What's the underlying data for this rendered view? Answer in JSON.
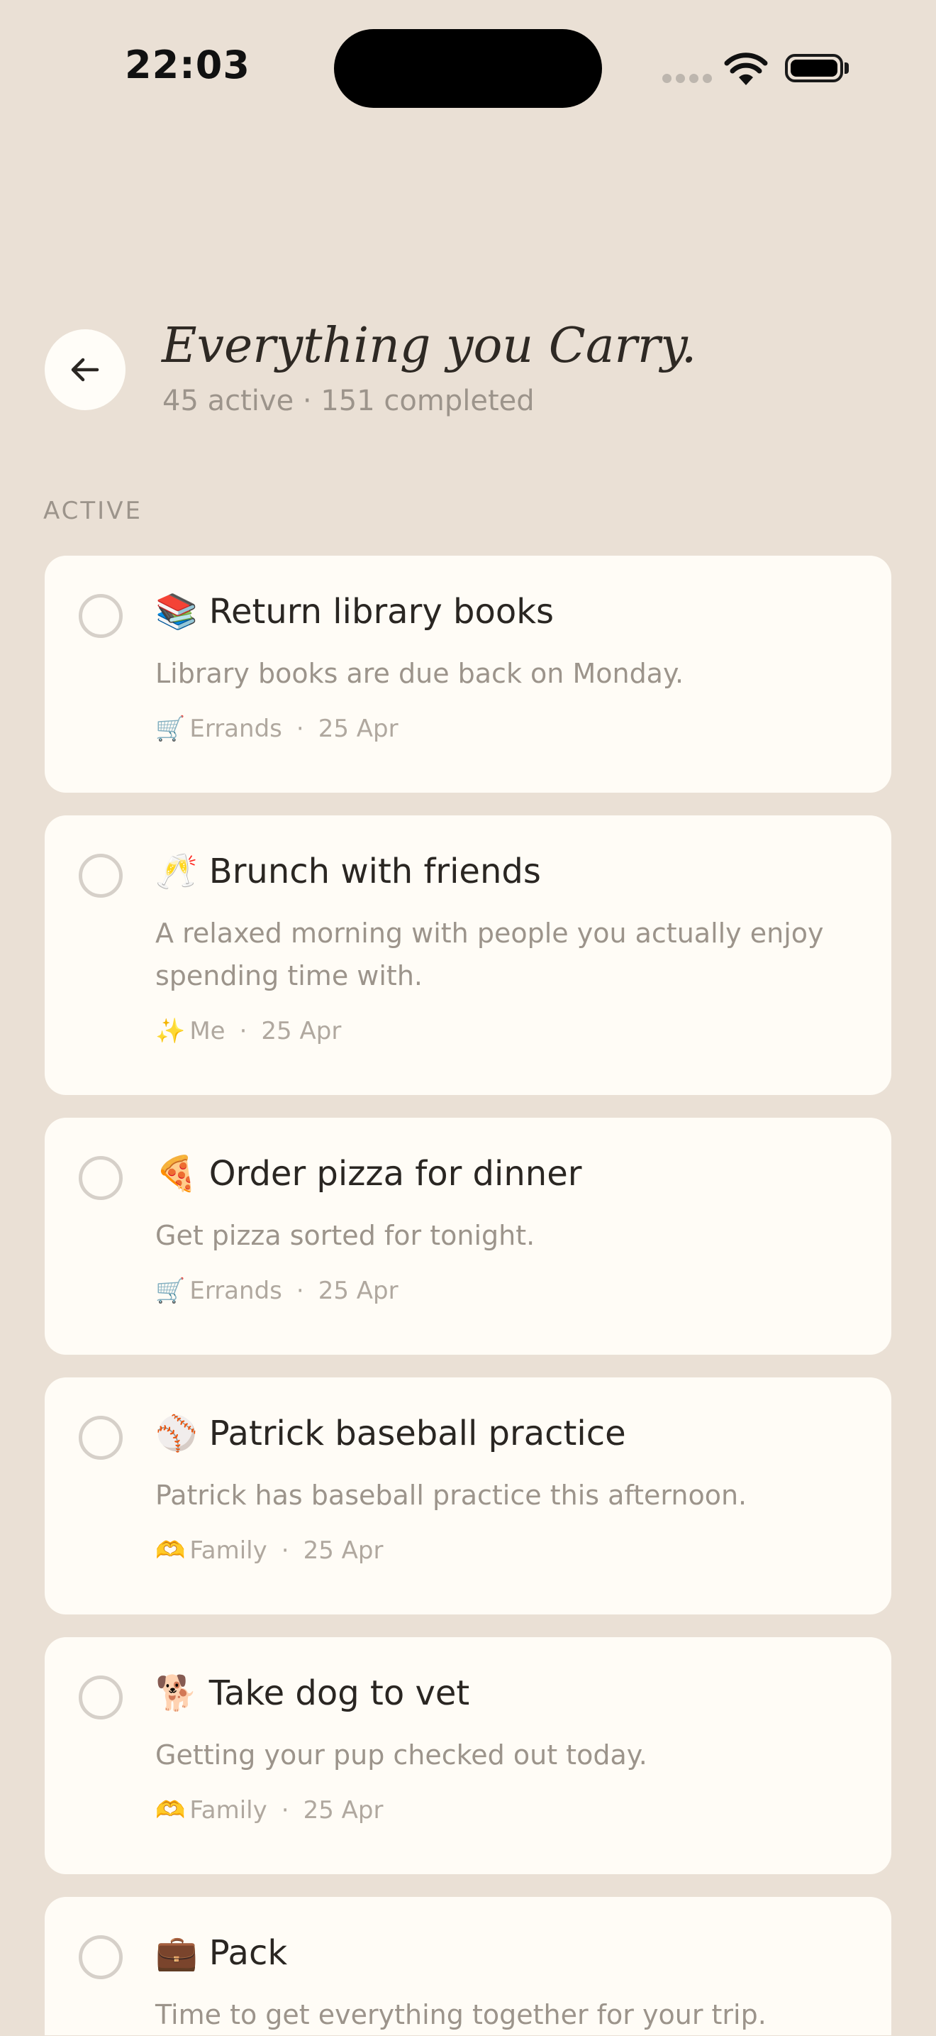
{
  "status_bar": {
    "time": "22:03"
  },
  "header": {
    "title": "Everything you Carry.",
    "subtitle": "45 active · 151 completed"
  },
  "section": {
    "label": "ACTIVE"
  },
  "tasks": [
    {
      "emoji": "📚",
      "title": "Return library books",
      "description": "Library books are due back on Monday.",
      "category_emoji": "🛒",
      "category": "Errands",
      "date": "25 Apr"
    },
    {
      "emoji": "🥂",
      "title": "Brunch with friends",
      "description": "A relaxed morning with people you actually enjoy spending time with.",
      "category_emoji": "✨",
      "category": "Me",
      "date": "25 Apr"
    },
    {
      "emoji": "🍕",
      "title": "Order pizza for dinner",
      "description": "Get pizza sorted for tonight.",
      "category_emoji": "🛒",
      "category": "Errands",
      "date": "25 Apr"
    },
    {
      "emoji": "⚾",
      "title": "Patrick baseball practice",
      "description": "Patrick has baseball practice this afternoon.",
      "category_emoji": "🫶",
      "category": "Family",
      "date": "25 Apr"
    },
    {
      "emoji": "🐕",
      "title": "Take dog to vet",
      "description": "Getting your pup checked out today.",
      "category_emoji": "🫶",
      "category": "Family",
      "date": "25 Apr"
    },
    {
      "emoji": "💼",
      "title": "Pack",
      "description": "Time to get everything together for your trip.",
      "category_emoji": "",
      "category": "",
      "date": ""
    }
  ]
}
